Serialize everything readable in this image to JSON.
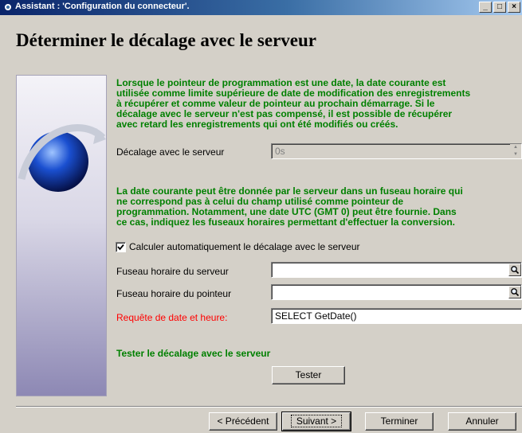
{
  "window": {
    "title": "Assistant : 'Configuration du connecteur'.",
    "controls": {
      "minimize": "_",
      "maximize": "□",
      "close": "×"
    }
  },
  "page": {
    "heading": "Déterminer le décalage avec le serveur"
  },
  "intro": {
    "lines": [
      "Lorsque le pointeur de programmation est une date, la date courante est",
      "utilisée comme limite supérieure de date de modification des enregistrements",
      "à récupérer et comme valeur de pointeur au prochain démarrage. Si le",
      "décalage avec le serveur n'est pas compensé, il est possible de récupérer",
      "avec retard les enregistrements qui ont été modifiés ou créés."
    ]
  },
  "offset": {
    "label": "Décalage avec le serveur",
    "value": "0s"
  },
  "timezone_info": {
    "lines": [
      "La date courante peut être donnée par le serveur dans un fuseau horaire qui",
      "ne correspond pas à celui du champ utilisé comme pointeur de",
      "programmation. Notamment, une date UTC (GMT 0) peut être fournie. Dans",
      "ce cas, indiquez les fuseaux horaires permettant d'effectuer la conversion."
    ]
  },
  "auto_compute": {
    "label": "Calculer automatiquement le décalage avec le serveur",
    "checked": true
  },
  "server_tz": {
    "label": "Fuseau horaire du serveur",
    "value": "",
    "icon": "search-icon"
  },
  "pointer_tz": {
    "label": "Fuseau horaire du pointeur",
    "value": "",
    "icon": "search-icon"
  },
  "date_query": {
    "label": "Requête de date et heure:",
    "value": "SELECT GetDate()"
  },
  "test": {
    "heading": "Tester le décalage avec le serveur",
    "button": "Tester"
  },
  "footer": {
    "previous": "< Précédent",
    "next": "Suivant >",
    "finish": "Terminer",
    "cancel": "Annuler"
  }
}
